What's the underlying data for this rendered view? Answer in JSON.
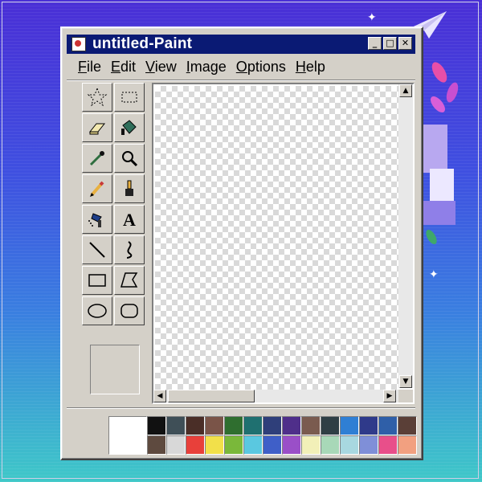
{
  "window": {
    "title": "untitled-Paint",
    "controls": [
      "_",
      "□",
      "✕"
    ]
  },
  "menu": [
    "File",
    "Edit",
    "View",
    "Image",
    "Options",
    "Help"
  ],
  "tools": [
    {
      "name": "free-form-select-tool",
      "icon": "star-select-icon"
    },
    {
      "name": "rect-select-tool",
      "icon": "rect-select-icon"
    },
    {
      "name": "eraser-tool",
      "icon": "eraser-icon"
    },
    {
      "name": "fill-tool",
      "icon": "paint-bucket-icon"
    },
    {
      "name": "color-picker-tool",
      "icon": "eyedropper-icon"
    },
    {
      "name": "magnifier-tool",
      "icon": "magnifier-icon"
    },
    {
      "name": "pencil-tool",
      "icon": "pencil-icon"
    },
    {
      "name": "brush-tool",
      "icon": "brush-icon"
    },
    {
      "name": "airbrush-tool",
      "icon": "airbrush-icon"
    },
    {
      "name": "text-tool",
      "icon": "text-icon"
    },
    {
      "name": "line-tool",
      "icon": "line-icon"
    },
    {
      "name": "curve-tool",
      "icon": "curve-icon"
    },
    {
      "name": "rectangle-tool",
      "icon": "rectangle-icon"
    },
    {
      "name": "polygon-tool",
      "icon": "polygon-icon"
    },
    {
      "name": "ellipse-tool",
      "icon": "ellipse-icon"
    },
    {
      "name": "rounded-rect-tool",
      "icon": "rounded-rect-icon"
    }
  ],
  "colors": {
    "foreground": "#000000",
    "background": "#ffffff",
    "palette": [
      "#111111",
      "#3f4f57",
      "#4a2e27",
      "#7a5448",
      "#2f6e2f",
      "#1f7070",
      "#2f3f7a",
      "#4f2f8a",
      "#7a5b4f",
      "#2f3f45",
      "#2f7fd4",
      "#2f3a8a",
      "#2f5fa8",
      "#5a3f37",
      "#5e4a3f",
      "#d8d8d8",
      "#e8403a",
      "#f2e04a",
      "#7ab83a",
      "#5ac8e0",
      "#3f5fc8",
      "#9a4fc8",
      "#f2f0b8",
      "#a8d8b8",
      "#a8d8e0",
      "#7f8fd8",
      "#e84f8a",
      "#f2a080"
    ]
  }
}
